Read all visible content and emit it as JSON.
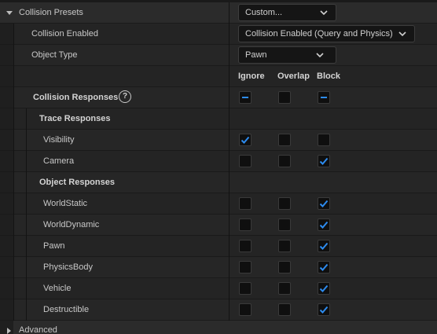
{
  "collision_presets": {
    "label": "Collision Presets",
    "value": "Custom...",
    "expanded": true
  },
  "collision_enabled": {
    "label": "Collision Enabled",
    "value": "Collision Enabled (Query and Physics)"
  },
  "object_type": {
    "label": "Object Type",
    "value": "Pawn"
  },
  "columns": {
    "ignore": "Ignore",
    "overlap": "Overlap",
    "block": "Block"
  },
  "collision_responses": {
    "label": "Collision Responses",
    "ignore": "indeterminate",
    "overlap": "unchecked",
    "block": "indeterminate"
  },
  "trace_responses": {
    "label": "Trace Responses",
    "items": [
      {
        "name": "Visibility",
        "ignore": true,
        "overlap": false,
        "block": false
      },
      {
        "name": "Camera",
        "ignore": false,
        "overlap": false,
        "block": true
      }
    ]
  },
  "object_responses": {
    "label": "Object Responses",
    "items": [
      {
        "name": "WorldStatic",
        "ignore": false,
        "overlap": false,
        "block": true
      },
      {
        "name": "WorldDynamic",
        "ignore": false,
        "overlap": false,
        "block": true
      },
      {
        "name": "Pawn",
        "ignore": false,
        "overlap": false,
        "block": true
      },
      {
        "name": "PhysicsBody",
        "ignore": false,
        "overlap": false,
        "block": true
      },
      {
        "name": "Vehicle",
        "ignore": false,
        "overlap": false,
        "block": true
      },
      {
        "name": "Destructible",
        "ignore": false,
        "overlap": false,
        "block": true
      }
    ]
  },
  "advanced": {
    "label": "Advanced",
    "expanded": false
  },
  "colors": {
    "accent": "#1f7fe0",
    "check": "#2d8cf0"
  }
}
